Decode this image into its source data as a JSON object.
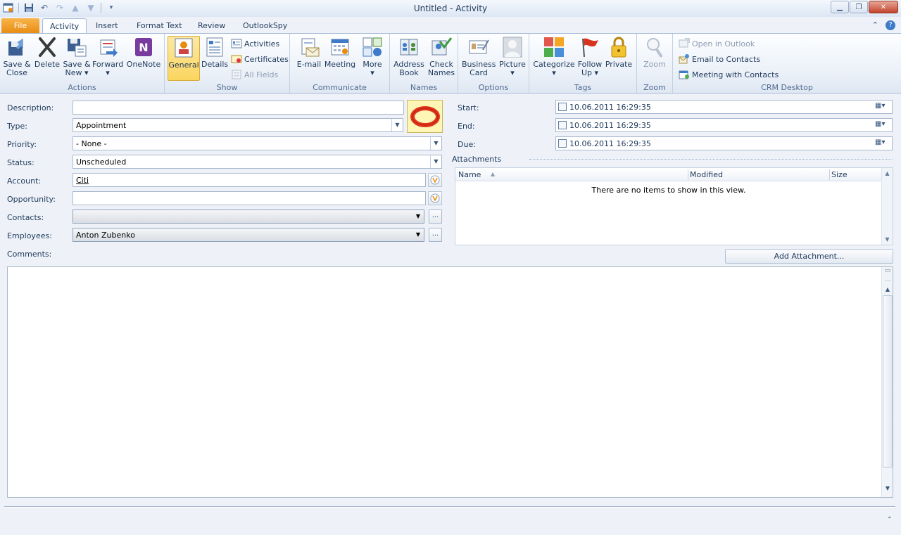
{
  "window": {
    "title": "Untitled  -  Activity"
  },
  "tabs": {
    "file": "File",
    "activity": "Activity",
    "insert": "Insert",
    "format_text": "Format Text",
    "review": "Review",
    "outlookspy": "OutlookSpy"
  },
  "ribbon": {
    "actions": {
      "label": "Actions",
      "save_close": [
        "Save &",
        "Close"
      ],
      "delete": "Delete",
      "save_new": [
        "Save &",
        "New ▾"
      ],
      "forward": [
        "Forward",
        "▾"
      ],
      "onenote": "OneNote"
    },
    "show": {
      "label": "Show",
      "general": "General",
      "details": "Details",
      "activities": "Activities",
      "certificates": "Certificates",
      "all_fields": "All Fields"
    },
    "communicate": {
      "label": "Communicate",
      "email": "E-mail",
      "meeting": "Meeting",
      "more": [
        "More",
        "▾"
      ]
    },
    "names": {
      "label": "Names",
      "address_book": [
        "Address",
        "Book"
      ],
      "check_names": [
        "Check",
        "Names"
      ]
    },
    "options": {
      "label": "Options",
      "business_card": [
        "Business",
        "Card"
      ],
      "picture": [
        "Picture",
        "▾"
      ]
    },
    "tags": {
      "label": "Tags",
      "categorize": [
        "Categorize",
        "▾"
      ],
      "follow_up": [
        "Follow",
        "Up ▾"
      ],
      "private": "Private"
    },
    "zoom": {
      "label": "Zoom",
      "zoom": "Zoom"
    },
    "crm": {
      "label": "CRM Desktop",
      "open_in_outlook": "Open in Outlook",
      "email_to_contacts": "Email to Contacts",
      "meeting_with_contacts": "Meeting with Contacts"
    }
  },
  "form": {
    "description_label": "Description:",
    "description_value": "",
    "type_label": "Type:",
    "type_value": "Appointment",
    "priority_label": "Priority:",
    "priority_value": "- None -",
    "status_label": "Status:",
    "status_value": "Unscheduled",
    "account_label": "Account:",
    "account_value": "Citi",
    "opportunity_label": "Opportunity:",
    "opportunity_value": "",
    "contacts_label": "Contacts:",
    "contacts_value": "",
    "employees_label": "Employees:",
    "employees_value": "Anton Zubenko",
    "comments_label": "Comments:",
    "ellipsis": "..."
  },
  "dates": {
    "start_label": "Start:",
    "start_value": "10.06.2011 16:29:35",
    "end_label": "End:",
    "end_value": "10.06.2011 16:29:35",
    "due_label": "Due:",
    "due_value": "10.06.2011 16:29:35"
  },
  "attachments": {
    "header": "Attachments",
    "columns": [
      "Name",
      "Modified",
      "Size"
    ],
    "empty_text": "There are no items to show in this view.",
    "add_button": "Add Attachment..."
  },
  "colors": {
    "file_tab": "#e88b12",
    "active_button": "#fbd55e",
    "ring": "#e0341c"
  }
}
